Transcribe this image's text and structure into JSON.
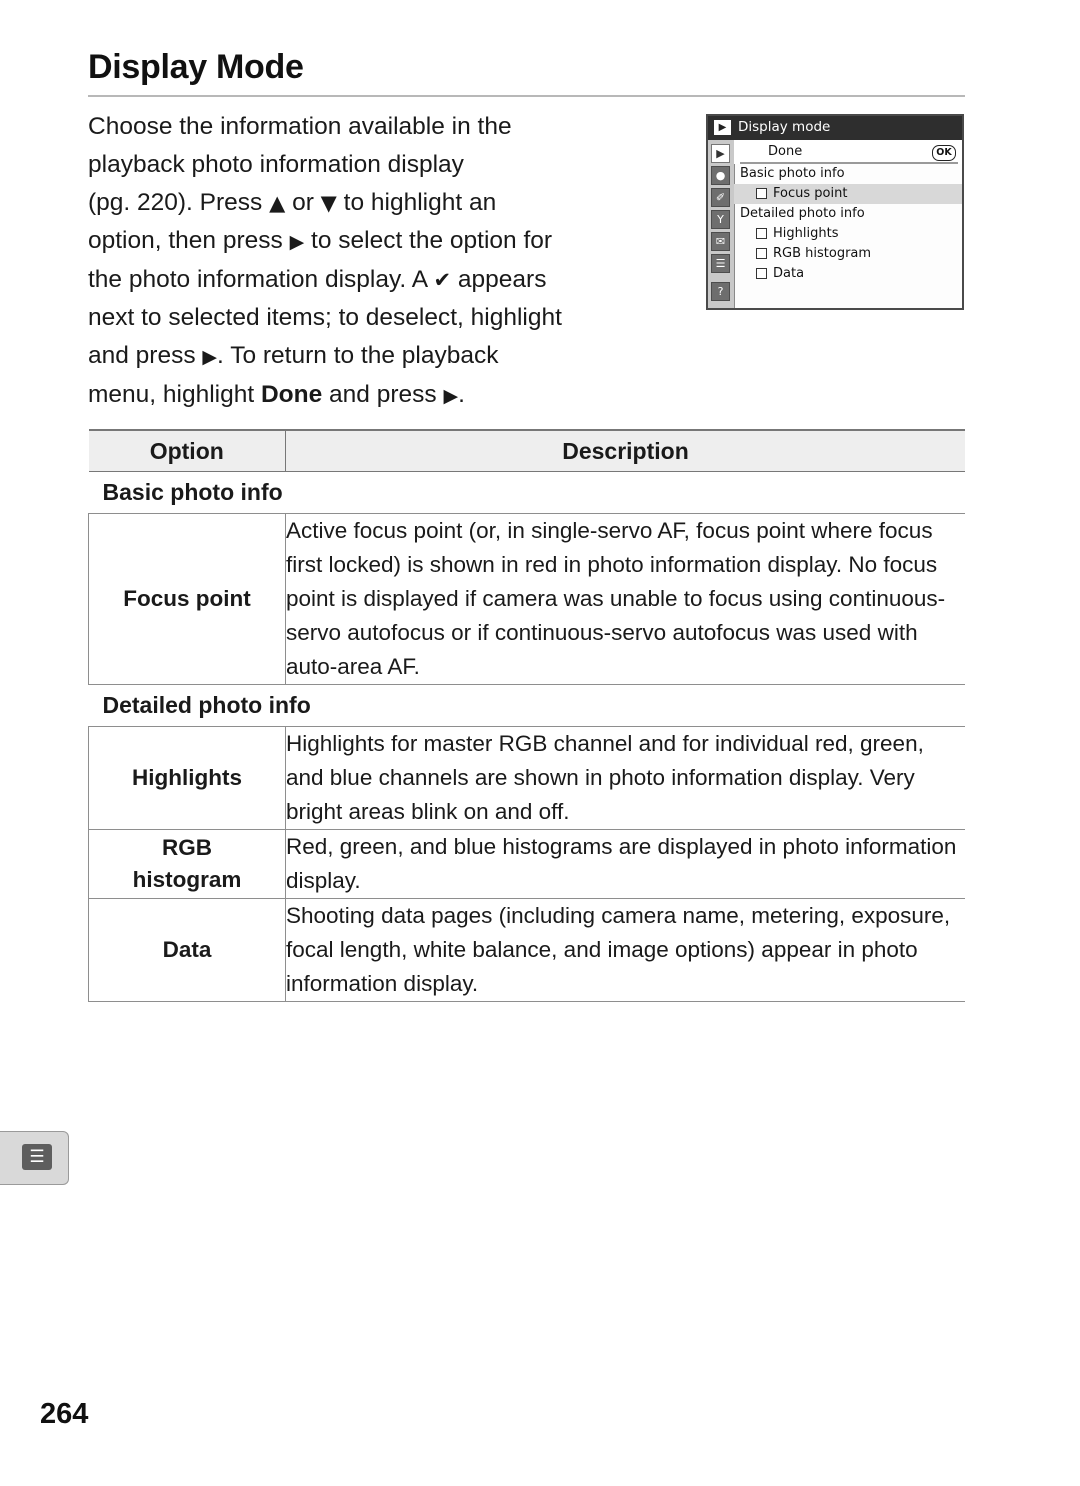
{
  "page": {
    "title": "Display Mode",
    "number": "264"
  },
  "intro": {
    "line1": "Choose the information available in the",
    "line2": "playback photo information display",
    "line3_a": "(pg. 220).  Press ",
    "up_arrow": "▲",
    "line3_b": " or ",
    "down_arrow": "▼",
    "line3_c": " to highlight an",
    "line4_a": "option, then press ",
    "right_arrow": "▶",
    "line4_b": " to select the option for",
    "line5_a": "the photo information display.  A ",
    "check_mark": "✔",
    "line5_b": " appears",
    "line6": "next to selected items; to deselect, highlight",
    "line7_a": "and press ",
    "line7_b": ".  To return to the playback",
    "line8_a": "menu, highlight ",
    "line8_bold": "Done",
    "line8_b": " and press ",
    "line8_c": "."
  },
  "lcd": {
    "title": "Display mode",
    "title_icon": "▶",
    "sidebar_icons": [
      "playback-icon",
      "shooting-icon",
      "custom-icon",
      "setup-icon",
      "retouch-icon",
      "recent-icon",
      "help-icon"
    ],
    "sidebar_glyphs": [
      "▶",
      "●",
      "✐",
      "Y",
      "✉",
      "☰",
      "?"
    ],
    "rows": [
      {
        "label": "Done",
        "type": "done",
        "badge": "OK"
      },
      {
        "label": "Basic photo info",
        "type": "section"
      },
      {
        "label": "Focus point",
        "type": "check",
        "highlight": true
      },
      {
        "label": "Detailed photo info",
        "type": "section"
      },
      {
        "label": "Highlights",
        "type": "check"
      },
      {
        "label": "RGB histogram",
        "type": "check"
      },
      {
        "label": "Data",
        "type": "check"
      }
    ]
  },
  "table": {
    "header": {
      "option": "Option",
      "description": "Description"
    },
    "sections": [
      {
        "heading": "Basic photo info"
      },
      {
        "heading": "Detailed photo info"
      }
    ],
    "rows": [
      {
        "option": "Focus point",
        "description": "Active focus point (or, in single-servo AF, focus point where focus first locked) is shown in red in photo information display.  No focus point is displayed if camera was unable to focus using continuous-servo autofocus or if continuous-servo autofocus was used with auto-area AF."
      },
      {
        "option": "Highlights",
        "description": "Highlights for master RGB channel and for individual red, green, and blue channels are shown in photo information display.  Very bright areas blink on and off."
      },
      {
        "option_line1": "RGB",
        "option_line2": "histogram",
        "description": "Red, green, and blue histograms are displayed in photo information display."
      },
      {
        "option": "Data",
        "description": "Shooting data pages (including camera name, metering, exposure, focal length, white balance, and image options) appear in photo information display."
      }
    ]
  },
  "corner": {
    "icon": "☰"
  }
}
